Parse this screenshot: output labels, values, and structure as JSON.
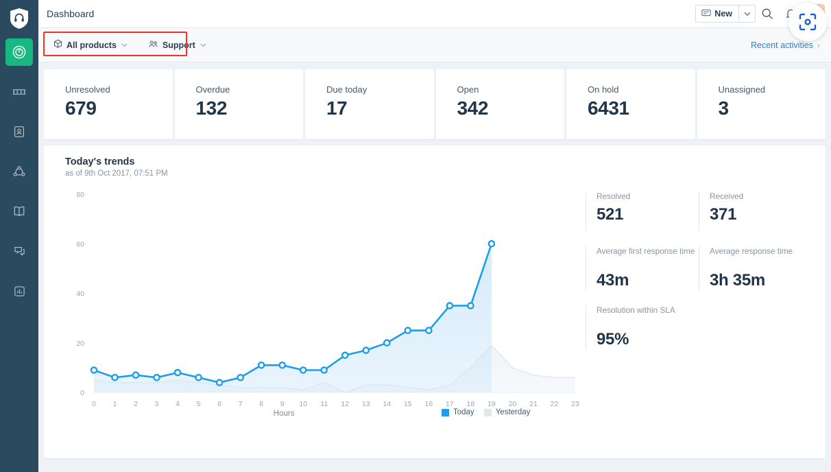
{
  "sidebar": {
    "logo_icon": "headset-shield-logo",
    "items": [
      {
        "icon": "gauge-icon",
        "name": "dashboard",
        "active": true
      },
      {
        "icon": "ticket-icon",
        "name": "tickets",
        "active": false
      },
      {
        "icon": "contact-card-icon",
        "name": "contacts",
        "active": false
      },
      {
        "icon": "network-icon",
        "name": "customers",
        "active": false
      },
      {
        "icon": "book-icon",
        "name": "solutions",
        "active": false
      },
      {
        "icon": "chat-bubbles-icon",
        "name": "forums",
        "active": false
      },
      {
        "icon": "bar-chart-icon",
        "name": "reports",
        "active": false
      }
    ]
  },
  "topbar": {
    "title": "Dashboard",
    "new_button": {
      "label": "New",
      "icon": "envelope-icon",
      "caret_icon": "chevron-down-icon"
    },
    "search_icon": "search-icon",
    "notification_icon": "bell-icon",
    "status_icon": "agent-status-icon",
    "status_badge_color": "#18b981",
    "capture_icon": "screen-capture-icon",
    "capture_accent_color": "#f8cdb4",
    "capture_icon_color": "#1a62c4"
  },
  "filterbar": {
    "highlight_color": "#ff2d20",
    "filters": [
      {
        "label": "All products",
        "icon": "cube-icon",
        "caret": "ˇ"
      },
      {
        "label": "Support",
        "icon": "people-icon",
        "caret": "ˇ"
      }
    ],
    "recent_activities": {
      "label": "Recent activities",
      "chevron": "›",
      "color": "#2b7fd4"
    }
  },
  "cards": [
    {
      "label": "Unresolved",
      "value": "679"
    },
    {
      "label": "Overdue",
      "value": "132"
    },
    {
      "label": "Due today",
      "value": "17"
    },
    {
      "label": "Open",
      "value": "342"
    },
    {
      "label": "On hold",
      "value": "6431"
    },
    {
      "label": "Unassigned",
      "value": "3"
    }
  ],
  "trends": {
    "title": "Today's trends",
    "subtitle": "as of 9th Oct 2017, 07:51 PM"
  },
  "stats": [
    {
      "label": "Resolved",
      "value": "521",
      "lines": 1
    },
    {
      "label": "Received",
      "value": "371",
      "lines": 1
    },
    {
      "label": "Average first response time",
      "value": "43m",
      "lines": 2
    },
    {
      "label": "Average response time",
      "value": "3h 35m",
      "lines": 2
    },
    {
      "label": "Resolution within SLA",
      "value": "95%",
      "lines": 2
    }
  ],
  "chart_data": {
    "type": "area",
    "title": "Today's trends",
    "xlabel": "Hours",
    "ylabel": "",
    "x": [
      0,
      1,
      2,
      3,
      4,
      5,
      6,
      7,
      8,
      9,
      10,
      11,
      12,
      13,
      14,
      15,
      16,
      17,
      18,
      19,
      20,
      21,
      22,
      23
    ],
    "xlim": [
      0,
      23
    ],
    "ylim": [
      0,
      80
    ],
    "yticks": [
      0,
      20,
      40,
      60,
      80
    ],
    "xticks": [
      "0",
      "1",
      "2",
      "3",
      "4",
      "5",
      "6",
      "7",
      "8",
      "9",
      "10",
      "11",
      "12",
      "13",
      "14",
      "15",
      "16",
      "17",
      "18",
      "19",
      "20",
      "21",
      "22",
      "23"
    ],
    "grid": false,
    "legend_position": "bottom-right",
    "series": [
      {
        "name": "Today",
        "color": "#1e9eea",
        "fill": "#d6ebfa",
        "markers": true,
        "values": [
          9,
          6,
          7,
          6,
          8,
          6,
          4,
          6,
          11,
          11,
          9,
          9,
          15,
          17,
          20,
          25,
          25,
          35,
          35,
          60,
          null,
          null,
          null,
          null
        ]
      },
      {
        "name": "Yesterday",
        "color": "#dfe4e9",
        "fill": "#f4f7f9",
        "markers": false,
        "values": [
          5,
          4,
          4,
          4,
          5,
          4,
          3,
          2,
          2,
          2,
          1,
          4,
          0,
          3,
          3,
          2,
          1,
          3,
          10,
          19,
          10,
          7,
          6,
          6
        ]
      }
    ]
  }
}
